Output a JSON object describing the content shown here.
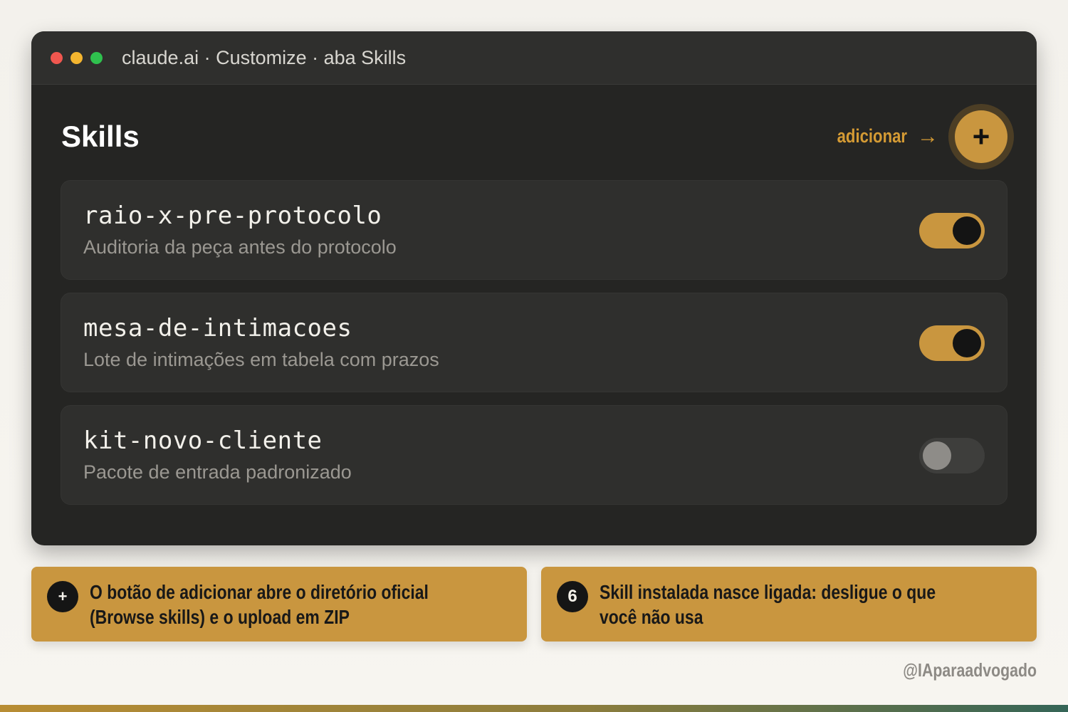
{
  "window": {
    "title": "claude.ai · Customize · aba Skills"
  },
  "header": {
    "title": "Skills",
    "add_label": "adicionar",
    "add_arrow": "→",
    "add_button_symbol": "+"
  },
  "skills": [
    {
      "name": "raio-x-pre-protocolo",
      "description": "Auditoria da peça antes do protocolo",
      "enabled": true
    },
    {
      "name": "mesa-de-intimacoes",
      "description": "Lote de intimações em tabela com prazos",
      "enabled": true
    },
    {
      "name": "kit-novo-cliente",
      "description": "Pacote de entrada padronizado",
      "enabled": false
    }
  ],
  "notes": [
    {
      "badge": "+",
      "text": "O botão de adicionar abre o diretório oficial (Browse skills) e o upload em ZIP"
    },
    {
      "badge": "6",
      "text": "Skill instalada nasce ligada: desligue o que você não usa"
    }
  ],
  "watermark": "@IAparaadvogado",
  "colors": {
    "accent": "#c9963f",
    "window_bg": "#252523",
    "card_bg": "#2f2f2d"
  }
}
